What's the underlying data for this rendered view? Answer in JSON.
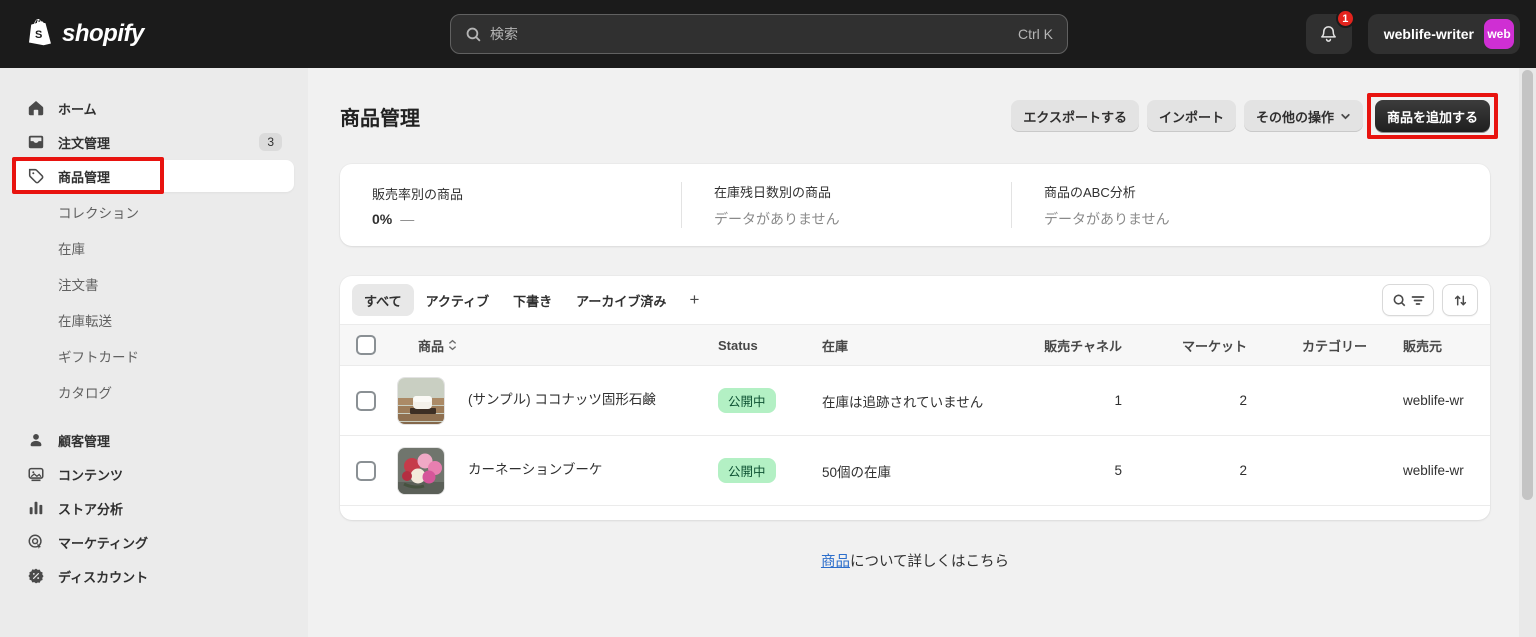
{
  "topbar": {
    "logo": "shopify",
    "search": {
      "placeholder": "検索",
      "shortcut": "Ctrl K"
    },
    "notification_badge": "1",
    "account": {
      "name": "weblife-writer",
      "avatar": "web"
    }
  },
  "sidebar": {
    "items": [
      {
        "label": "ホーム"
      },
      {
        "label": "注文管理",
        "badge": "3"
      },
      {
        "label": "商品管理"
      },
      {
        "label": "コレクション"
      },
      {
        "label": "在庫"
      },
      {
        "label": "注文書"
      },
      {
        "label": "在庫転送"
      },
      {
        "label": "ギフトカード"
      },
      {
        "label": "カタログ"
      },
      {
        "label": "顧客管理"
      },
      {
        "label": "コンテンツ"
      },
      {
        "label": "ストア分析"
      },
      {
        "label": "マーケティング"
      },
      {
        "label": "ディスカウント"
      }
    ]
  },
  "header": {
    "title": "商品管理",
    "export_label": "エクスポートする",
    "import_label": "インポート",
    "more_actions_label": "その他の操作",
    "add_product_label": "商品を追加する"
  },
  "stats": {
    "cards": [
      {
        "label": "販売率別の商品",
        "value": "0%",
        "suffix": "—"
      },
      {
        "label": "在庫残日数別の商品",
        "value": "データがありません"
      },
      {
        "label": "商品のABC分析",
        "value": "データがありません"
      }
    ]
  },
  "products": {
    "tabs": [
      {
        "label": "すべて"
      },
      {
        "label": "アクティブ"
      },
      {
        "label": "下書き"
      },
      {
        "label": "アーカイブ済み"
      }
    ],
    "add_tab_label": "+",
    "columns": {
      "product": "商品",
      "status": "Status",
      "inventory": "在庫",
      "sales_channels": "販売チャネル",
      "markets": "マーケット",
      "category": "カテゴリー",
      "vendor": "販売元"
    },
    "rows": [
      {
        "name": "(サンプル) ココナッツ固形石鹸",
        "status": "公開中",
        "inventory": "在庫は追跡されていません",
        "sales_channels": "1",
        "markets": "2",
        "category": "",
        "vendor": "weblife-wr"
      },
      {
        "name": "カーネーションブーケ",
        "status": "公開中",
        "inventory": "50個の在庫",
        "sales_channels": "5",
        "markets": "2",
        "category": "",
        "vendor": "weblife-wr"
      }
    ]
  },
  "footer": {
    "link_text": "商品",
    "rest_text": "について詳しくはこちら"
  },
  "colors": {
    "topbar_bg": "#1b1b1b",
    "sidebar_bg": "#ebebeb",
    "page_bg": "#f1f1f1",
    "annotation_red": "#e8130f",
    "status_badge_bg": "#b3f0c4",
    "status_badge_text": "#0d5132",
    "avatar_bg": "#cf2fd3",
    "link_blue": "#2c6ecb"
  }
}
